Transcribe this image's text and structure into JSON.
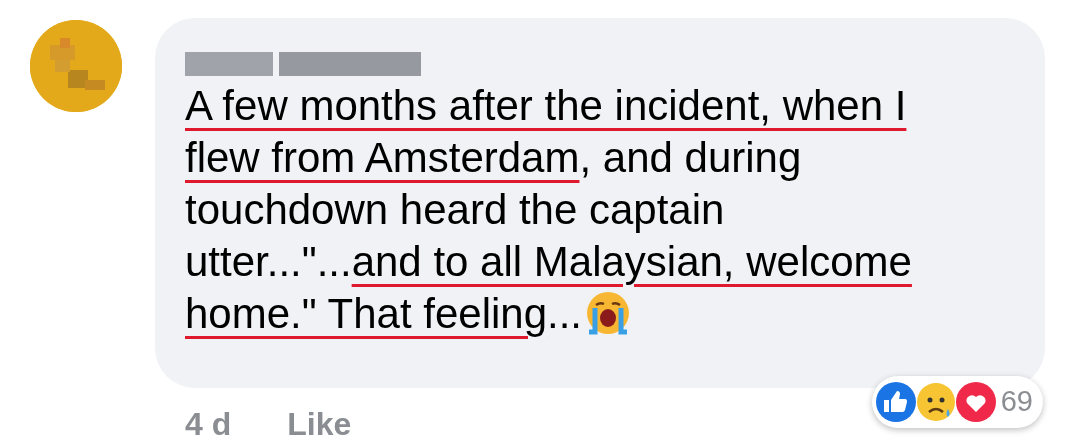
{
  "comment": {
    "lines": [
      [
        {
          "text": "A few months after the incident, when I",
          "underlined": true
        }
      ],
      [
        {
          "text": "flew from Amsterdam",
          "underlined": true
        },
        {
          "text": ", and during",
          "underlined": false
        }
      ],
      [
        {
          "text": "touchdown heard the captain",
          "underlined": false
        }
      ],
      [
        {
          "text": "utter...\"...",
          "underlined": false
        },
        {
          "text": "and to all Malaysian, welcome",
          "underlined": true
        }
      ],
      [
        {
          "text": "home.\" That feeling",
          "underlined": true
        },
        {
          "text": "...",
          "underlined": false
        }
      ]
    ],
    "time": "4 d",
    "like_label": "Like",
    "reaction_count": "69"
  }
}
